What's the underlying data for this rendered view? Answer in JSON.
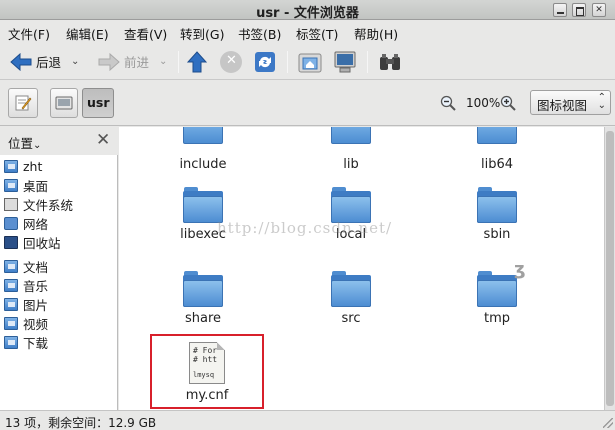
{
  "window": {
    "title": "usr - 文件浏览器"
  },
  "menu": [
    "文件(F)",
    "编辑(E)",
    "查看(V)",
    "转到(G)",
    "书签(B)",
    "标签(T)",
    "帮助(H)"
  ],
  "toolbar": {
    "back_label": "后退",
    "forward_label": "前进"
  },
  "location": {
    "current_folder": "usr",
    "zoom": "100%",
    "view_mode": "图标视图"
  },
  "sidebar": {
    "header": "位置",
    "items": [
      "zht",
      "桌面",
      "文件系统",
      "网络",
      "回收站",
      "文档",
      "音乐",
      "图片",
      "视频",
      "下载"
    ]
  },
  "files": [
    {
      "name": "include",
      "type": "folder"
    },
    {
      "name": "lib",
      "type": "folder"
    },
    {
      "name": "lib64",
      "type": "folder"
    },
    {
      "name": "libexec",
      "type": "folder"
    },
    {
      "name": "local",
      "type": "folder"
    },
    {
      "name": "sbin",
      "type": "folder"
    },
    {
      "name": "share",
      "type": "folder"
    },
    {
      "name": "src",
      "type": "folder"
    },
    {
      "name": "tmp",
      "type": "folder"
    },
    {
      "name": "my.cnf",
      "type": "text-file",
      "preview": [
        "# For",
        "# htt",
        "lmysq"
      ]
    }
  ],
  "watermark": "http://blog.csdn.net/",
  "status": {
    "text": "13 项，剩余空间：12.9 GB"
  },
  "colors": {
    "highlight": "#d8202b",
    "folder": "#4d8dd2"
  }
}
